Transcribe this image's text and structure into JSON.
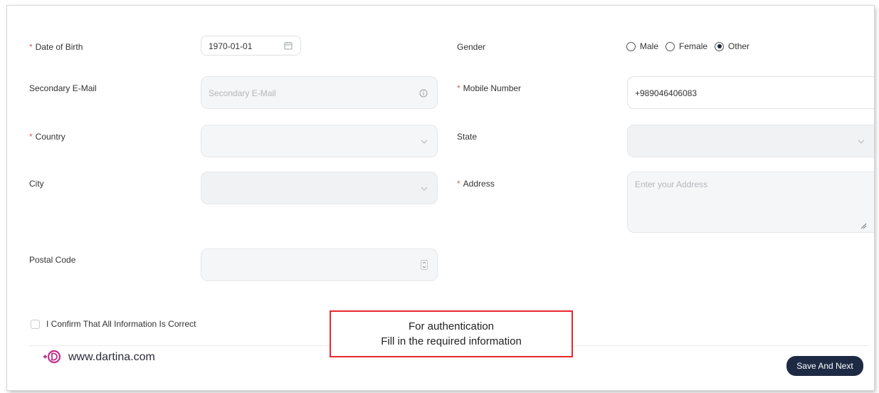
{
  "form": {
    "dob": {
      "label": "Date of Birth",
      "required": "*",
      "value": "1970-01-01"
    },
    "gender": {
      "label": "Gender",
      "options": [
        "Male",
        "Female",
        "Other"
      ],
      "selected": "Other"
    },
    "secondary_email": {
      "label": "Secondary E-Mail",
      "placeholder": "Secondary E-Mail"
    },
    "mobile": {
      "label": "Mobile Number",
      "required": "*",
      "value": "+989046406083"
    },
    "country": {
      "label": "Country",
      "required": "*"
    },
    "state": {
      "label": "State"
    },
    "city": {
      "label": "City"
    },
    "address": {
      "label": "Address",
      "required": "*",
      "placeholder": "Enter your Address"
    },
    "postal": {
      "label": "Postal Code"
    },
    "confirm": {
      "label": "I Confirm That All Information Is Correct",
      "checked": false
    }
  },
  "actions": {
    "save_next": "Save And Next"
  },
  "annotation": {
    "line1": "For authentication",
    "line2": "Fill in the required information"
  },
  "brand": {
    "website": "www.dartina.com"
  },
  "colors": {
    "required": "#e35a5a",
    "button": "#1e2a44",
    "annotation_border": "#e8282e",
    "logo": "#c0308a"
  }
}
